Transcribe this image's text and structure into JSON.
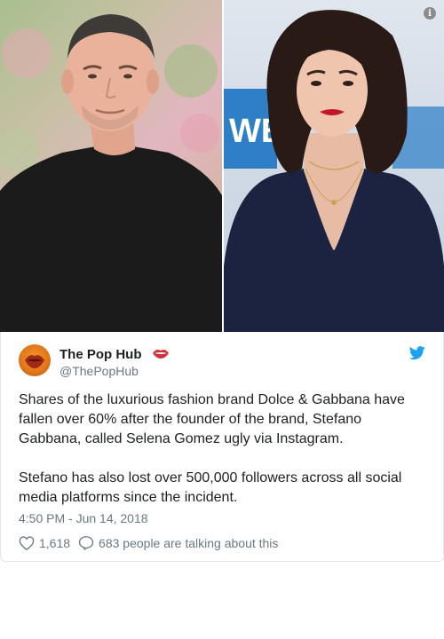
{
  "media": {
    "left_photo": "man in black t-shirt",
    "right_photo": "woman in navy dress",
    "info_icon_glyph": "i"
  },
  "tweet": {
    "author_name": "The Pop Hub",
    "author_handle": "@ThePopHub",
    "name_emoji": "lips-icon",
    "paragraphs": [
      "Shares of the luxurious fashion brand Dolce & Gabbana have fallen over 60% after the founder of the brand, Stefano Gabbana, called Selena Gomez ugly via Instagram.",
      "Stefano has also lost over 500,000 followers across all social media platforms since the incident."
    ],
    "timestamp": "4:50 PM - Jun 14, 2018",
    "likes": "1,618",
    "conversation": "683 people are talking about this"
  },
  "colors": {
    "twitter_blue": "#1da1f2",
    "secondary_text": "#697882",
    "primary_text": "#1c2022",
    "border": "#e1e8ed",
    "lips": "#d0313a"
  }
}
